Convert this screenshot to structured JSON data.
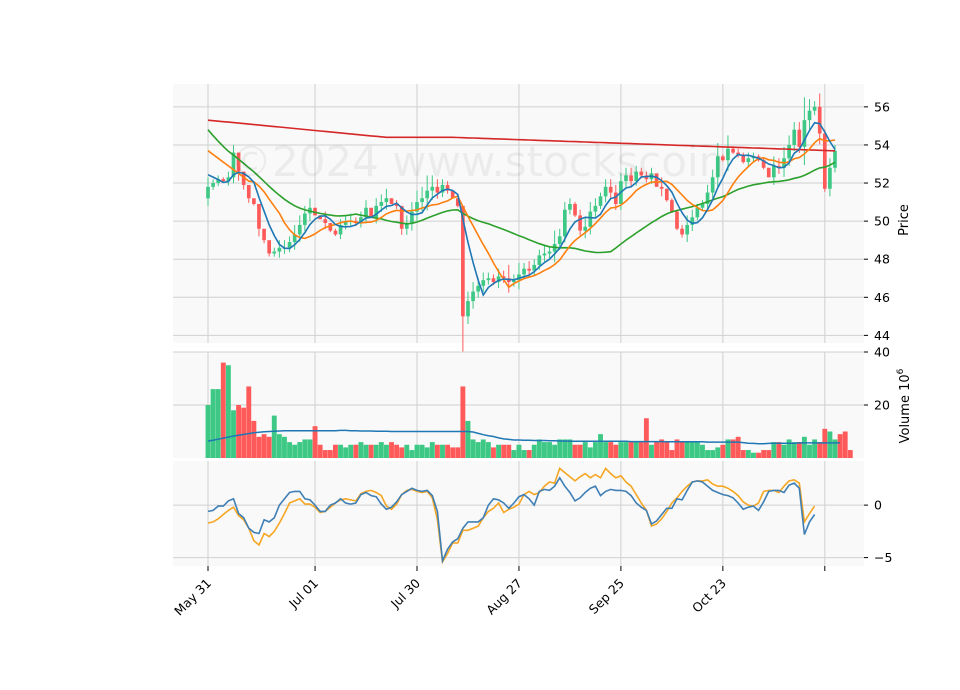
{
  "watermark": "©2024 www.stockscoin",
  "colors": {
    "up": "#3dc985",
    "down": "#ff5a5a",
    "ma_short": "#1f77b4",
    "ma_mid": "#ff7f0e",
    "ma_long": "#2ca02c",
    "ma_xlong": "#d62728",
    "vol_ma": "#1f77b4",
    "macd": "#3f7fb5",
    "signal": "#f5a623",
    "panel_bg": "#f9f9f9",
    "grid": "#d0d0d0"
  },
  "chart_data": [
    {
      "type": "candlestick",
      "panel": "price",
      "ylabel": "Price",
      "ylim": [
        43.6,
        57.2
      ],
      "yticks": [
        44,
        46,
        48,
        50,
        52,
        54,
        56
      ],
      "x_tick_labels": [
        "May 31",
        "Jul 01",
        "Jul 30",
        "Aug 27",
        "Sep 25",
        "Oct 23",
        ""
      ],
      "x_tick_index": [
        0,
        21,
        41,
        61,
        81,
        101,
        121
      ],
      "grid": true,
      "close": [
        51.8,
        52,
        52.2,
        52.1,
        52.3,
        53.6,
        52.6,
        51.9,
        51.2,
        50.9,
        49.6,
        49,
        48.3,
        48.4,
        48.6,
        48.6,
        48.9,
        49.3,
        49.8,
        50.4,
        50.7,
        50.3,
        50.1,
        49.9,
        49.5,
        49.3,
        49.8,
        50,
        50,
        49.9,
        50.2,
        50.7,
        50.2,
        50.8,
        51,
        51.2,
        50.9,
        50.8,
        49.6,
        49.9,
        50.5,
        51,
        51.2,
        51.6,
        51.8,
        51.5,
        51.9,
        51.6,
        51.2,
        50.8,
        45,
        45.8,
        46.3,
        46.6,
        46.9,
        47,
        46.8,
        47.1,
        47,
        46.8,
        46.9,
        47.2,
        47.5,
        47.4,
        47.7,
        48.2,
        48.3,
        48.4,
        48.8,
        49.2,
        50.6,
        50.9,
        50.3,
        49.5,
        49.7,
        50.5,
        50.8,
        51.3,
        51.8,
        51.5,
        50.9,
        52.1,
        52.4,
        52.1,
        52.6,
        52.4,
        52.2,
        52.5,
        51.8,
        51.7,
        51.1,
        50.5,
        49.6,
        49.3,
        49.8,
        50.2,
        50.7,
        50.9,
        51.5,
        52.3,
        53.4,
        53.2,
        53.8,
        53.6,
        53.5,
        53.1,
        53.3,
        53.4,
        53.2,
        52.8,
        52.3,
        52.9,
        52.8,
        53.3,
        54,
        54.8,
        53.9,
        55.3,
        55.8,
        56,
        54.6,
        51.7,
        52.8,
        53.7
      ],
      "high": [
        52.3,
        52.2,
        52.4,
        52.3,
        52.6,
        54,
        53,
        52.3,
        51.6,
        51.1,
        50.4,
        49.4,
        48.8,
        48.6,
        49,
        49,
        49.2,
        49.8,
        50.3,
        50.8,
        51.2,
        50.7,
        50.3,
        50.5,
        49.8,
        49.6,
        50.1,
        50.3,
        50.4,
        50.2,
        50.5,
        51.1,
        50.7,
        51.2,
        51.4,
        51.7,
        51.2,
        51.1,
        50.4,
        50.3,
        51,
        51.6,
        51.8,
        52.4,
        52.4,
        52.2,
        52.2,
        52.1,
        51.6,
        51.1,
        47,
        46.3,
        46.8,
        47,
        47.3,
        47.3,
        47.2,
        47.5,
        47.4,
        47.7,
        47.2,
        47.8,
        47.8,
        47.9,
        48,
        48.5,
        48.7,
        48.7,
        49.5,
        49.6,
        51,
        51.2,
        51,
        50.6,
        50.2,
        51,
        51.2,
        51.5,
        52.2,
        52.2,
        51.9,
        52.5,
        52.8,
        52.8,
        52.9,
        52.8,
        52.6,
        52.8,
        52.5,
        52.3,
        51.6,
        51.2,
        50.6,
        49.8,
        50.3,
        50.6,
        50.9,
        51.1,
        51.9,
        52.7,
        54.1,
        53.5,
        54.5,
        53.9,
        53.8,
        53.6,
        53.6,
        53.6,
        53.5,
        53.3,
        52.8,
        53.4,
        53.3,
        53.9,
        54.5,
        55.2,
        55.2,
        56.5,
        56.4,
        56.3,
        56.7,
        54.8,
        53.3,
        54
      ]
    },
    {
      "type": "bar",
      "panel": "volume",
      "ylabel": "Volume",
      "ylabel_exponent": "6",
      "ylim": [
        0,
        40
      ],
      "yticks": [
        20,
        40
      ],
      "values": [
        20,
        26,
        26,
        36,
        35,
        18,
        20,
        19,
        27,
        14,
        8,
        9,
        8,
        16,
        9,
        8,
        6,
        5,
        6,
        7,
        7,
        12,
        5,
        3,
        3,
        5,
        5,
        4,
        5,
        5,
        6,
        5,
        5,
        5,
        6,
        5,
        6,
        5,
        4,
        5,
        3,
        5,
        5,
        4,
        6,
        5,
        5,
        5,
        4,
        4,
        27,
        14,
        7,
        6,
        7,
        6,
        4,
        5,
        5,
        5,
        3,
        5,
        3,
        3,
        5,
        7,
        6,
        6,
        5,
        7,
        7,
        7,
        5,
        5,
        6,
        4,
        6,
        9,
        6,
        6,
        5,
        6,
        6,
        6,
        6,
        6,
        15,
        5,
        6,
        7,
        6,
        3,
        7,
        6,
        6,
        6,
        6,
        5,
        3,
        3,
        4,
        5,
        7,
        7,
        8,
        3,
        3,
        2,
        2,
        3,
        3,
        6,
        6,
        5,
        7,
        6,
        6,
        8,
        5,
        7,
        6,
        11,
        10,
        7,
        9,
        10,
        3
      ],
      "ma": [
        6.4,
        6.7,
        7.1,
        7.5,
        7.9,
        8.3,
        8.6,
        8.9,
        9.2,
        9.5,
        9.7,
        9.9,
        10,
        10.1,
        10.2,
        10.3,
        10.3,
        10.3,
        10.3,
        10.3,
        10.3,
        10.3,
        10.3,
        10.3,
        10.3,
        10.3,
        10.4,
        10.4,
        10.3,
        10.3,
        10.2,
        10.2,
        10.2,
        10.1,
        10.1,
        10.1,
        10,
        10,
        10,
        10,
        10,
        10,
        10,
        10,
        10,
        10,
        10,
        10,
        10,
        10,
        10,
        10,
        9.8,
        9.3,
        8.8,
        8.4,
        8.1,
        7.6,
        7.2,
        7,
        6.8,
        6.8,
        6.7,
        6.7,
        6.6,
        6.6,
        6.6,
        6.5,
        6.5,
        6.4,
        6.4,
        6.3,
        6.3,
        6.3,
        6.3,
        6.3,
        6.3,
        6.3,
        6.3,
        6.3,
        6.3,
        6.3,
        6.3,
        6.2,
        6.2,
        6.2,
        6.2,
        6.2,
        6.2,
        6.2,
        6.1,
        6.1,
        6.1,
        6.1,
        6.1,
        6.1,
        6.1,
        6.1,
        6,
        6,
        6,
        6,
        6,
        6,
        6,
        5.8,
        5.6,
        5.5,
        5.4,
        5.4,
        5.5,
        5.6,
        5.6,
        5.6,
        5.6,
        5.6,
        5.7,
        5.7,
        5.7,
        5.7,
        5.7,
        5.7,
        5.7,
        5.7,
        5.7
      ]
    },
    {
      "type": "line",
      "panel": "macd",
      "ylim": [
        -5.8,
        4.2
      ],
      "yticks": [
        -5,
        0
      ],
      "macd": [
        -0.6,
        -0.5,
        -0.1,
        -0.1,
        0.4,
        0.6,
        -0.8,
        -1.2,
        -2.2,
        -2.6,
        -2.7,
        -1.4,
        -1.6,
        -1.2,
        0,
        0.6,
        1.2,
        1.3,
        1.3,
        0.6,
        0.5,
        0,
        -0.6,
        -0.6,
        0,
        0.2,
        0.6,
        0.2,
        0.1,
        0.2,
        1,
        1.2,
        0.9,
        0.8,
        0.1,
        -0.4,
        -0.2,
        0.3,
        1,
        1.3,
        1.6,
        1.4,
        1.3,
        1.4,
        0.9,
        -0.6,
        -5.3,
        -4.2,
        -3.5,
        -3.2,
        -2.2,
        -1.6,
        -1.6,
        -1.6,
        -1.2,
        0,
        0.6,
        0.5,
        0.2,
        -0.3,
        0.2,
        0.8,
        1,
        0.6,
        0,
        1.3,
        1.5,
        1.4,
        1.8,
        2.6,
        1.8,
        1.2,
        0.4,
        0.7,
        1.2,
        1.6,
        1.8,
        0.9,
        1.3,
        1.5,
        1.4,
        1.4,
        1.3,
        0.9,
        0.2,
        -0.2,
        -0.5,
        -1.8,
        -1.5,
        -0.9,
        -0.3,
        -0.3,
        0.6,
        0.5,
        1.4,
        2.2,
        2.3,
        2.2,
        1.8,
        1.4,
        1.2,
        1,
        0.9,
        0.7,
        0.2,
        -0.4,
        -0.2,
        -0.1,
        -0.5,
        0.3,
        1.3,
        1.4,
        1.4,
        1.2,
        1.9,
        2.1,
        1.6,
        -2.8,
        -1.6,
        -0.9
      ],
      "signal": [
        -1.7,
        -1.6,
        -1.3,
        -0.9,
        -0.5,
        -0.2,
        -1,
        -1.4,
        -2.2,
        -3.4,
        -3.8,
        -2.7,
        -3,
        -2.5,
        -1.7,
        -0.8,
        0.2,
        0.4,
        0.6,
        0.1,
        0.1,
        -0.2,
        -0.7,
        -0.6,
        -0.2,
        0.2,
        0.5,
        0.6,
        0.5,
        0.4,
        1.1,
        1.3,
        1.4,
        1.2,
        0.9,
        -0.1,
        -0.4,
        0.1,
        1,
        1.4,
        1.5,
        1.3,
        1.2,
        1.3,
        0.7,
        -1.4,
        -5.4,
        -4.6,
        -3.6,
        -3.6,
        -2.4,
        -2.4,
        -2.2,
        -2,
        -1.2,
        -0.6,
        -0.3,
        0.2,
        -0.7,
        -0.4,
        -0.2,
        0.1,
        1,
        1.3,
        1,
        1.2,
        1.8,
        2.2,
        2.1,
        3.5,
        3.1,
        2.7,
        2.3,
        2.7,
        3,
        2.6,
        2.9,
        2.6,
        3.5,
        3,
        2.6,
        2.8,
        2.2,
        1.8,
        1,
        0.2,
        -0.5,
        -2,
        -1.8,
        -1.3,
        -0.6,
        0.2,
        0.7,
        1.3,
        1.8,
        2.2,
        2.3,
        2.3,
        2.4,
        2,
        1.8,
        1.8,
        1.6,
        1.3,
        0.9,
        0.3,
        0,
        -0.1,
        0.2,
        1.3,
        1.4,
        1.4,
        1.2,
        1.8,
        2.3,
        2.4,
        2.1,
        -1.6,
        -0.8,
        -0.1
      ]
    }
  ]
}
